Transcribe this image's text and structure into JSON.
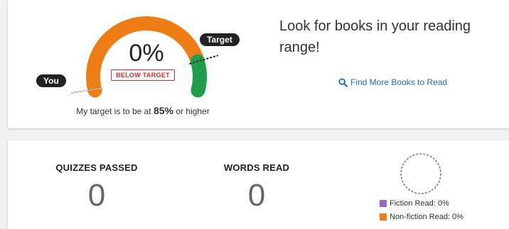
{
  "gauge": {
    "percent": "0%",
    "status_badge": "BELOW TARGET",
    "you_label": "You",
    "target_label": "Target",
    "statement_prefix": "My target is to be at",
    "statement_value": "85%",
    "statement_suffix": "or higher",
    "current_fraction": 0.0,
    "target_fraction": 0.85,
    "colors": {
      "below": "#ef7d16",
      "above": "#1e9e4a"
    }
  },
  "promo": {
    "text": "Look for books in your reading range!",
    "link_label": "Find More Books to Read",
    "link_icon": "search-icon"
  },
  "stats": {
    "quizzes_label": "QUIZZES PASSED",
    "quizzes_value": "0",
    "words_label": "WORDS READ",
    "words_value": "0"
  },
  "legend": {
    "fiction_label": "Fiction Read: 0%",
    "fiction_color": "#9c64c6",
    "nonfiction_label": "Non-fiction Read: 0%",
    "nonfiction_color": "#ef7d16"
  }
}
